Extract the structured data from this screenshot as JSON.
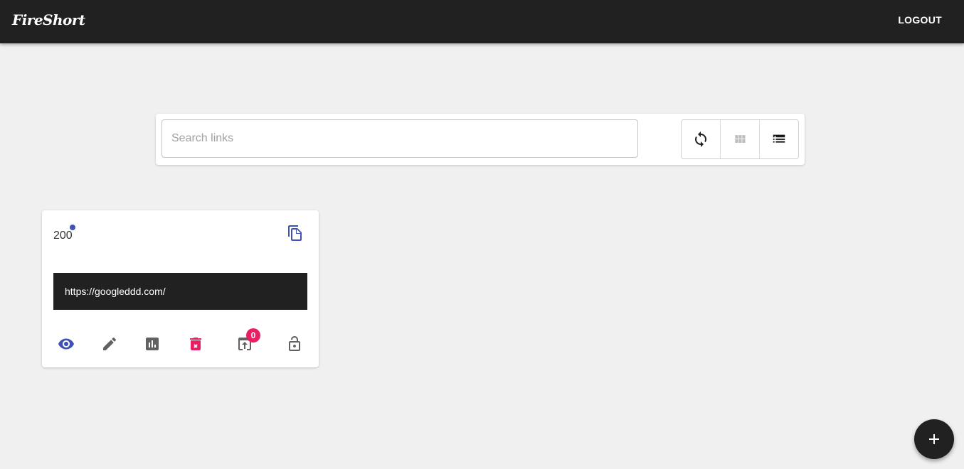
{
  "header": {
    "logo_text": "FireShort",
    "logout_label": "LOGOUT"
  },
  "search": {
    "placeholder": "Search links",
    "value": ""
  },
  "view_toggle": {
    "buttons": [
      {
        "icon": "refresh-icon"
      },
      {
        "icon": "grid-view-icon"
      },
      {
        "icon": "list-view-icon"
      }
    ]
  },
  "links": [
    {
      "hits": "200",
      "url": "https://googleddd.com/",
      "visibility_badge": "0",
      "actions": [
        "view-icon",
        "edit-icon",
        "analytics-icon",
        "delete-icon",
        "visibility-icon",
        "lock-icon"
      ]
    }
  ],
  "colors": {
    "appbar": "#212121",
    "primary": "#3f51b5",
    "secondary": "#e91e63",
    "icon_gray": "#616161",
    "background": "#f0f0f0"
  },
  "fab": {
    "icon": "add-icon"
  }
}
